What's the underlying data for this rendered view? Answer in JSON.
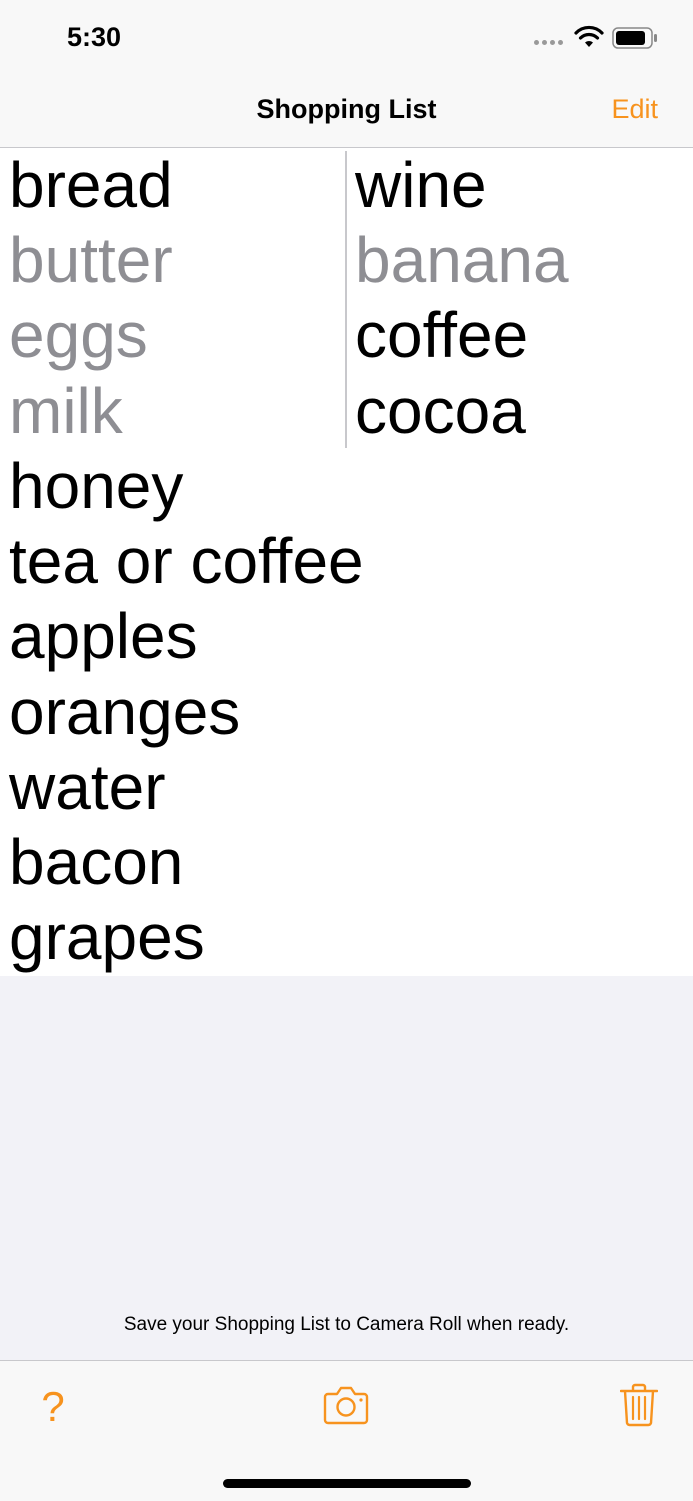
{
  "status_bar": {
    "time": "5:30"
  },
  "nav": {
    "title": "Shopping List",
    "edit_label": "Edit"
  },
  "list": {
    "left_column": [
      {
        "text": "bread",
        "checked": false
      },
      {
        "text": "butter",
        "checked": true
      },
      {
        "text": "eggs",
        "checked": true
      },
      {
        "text": "milk",
        "checked": true
      }
    ],
    "right_column": [
      {
        "text": "wine",
        "checked": false
      },
      {
        "text": "banana",
        "checked": true
      },
      {
        "text": "coffee",
        "checked": false
      },
      {
        "text": "cocoa",
        "checked": false
      }
    ],
    "full_width": [
      {
        "text": "honey",
        "checked": false
      },
      {
        "text": "tea or coffee",
        "checked": false
      },
      {
        "text": "apples",
        "checked": false
      },
      {
        "text": "oranges",
        "checked": false
      },
      {
        "text": "water",
        "checked": false
      },
      {
        "text": "bacon",
        "checked": false
      },
      {
        "text": "grapes",
        "checked": false
      }
    ]
  },
  "footer": {
    "note": "Save your Shopping List to Camera Roll when ready."
  },
  "toolbar": {
    "help_symbol": "?",
    "icons": [
      "help-icon",
      "camera-icon",
      "trash-icon"
    ]
  },
  "colors": {
    "accent": "#f7931e",
    "checked_text": "#8e8e93",
    "text": "#000000"
  }
}
